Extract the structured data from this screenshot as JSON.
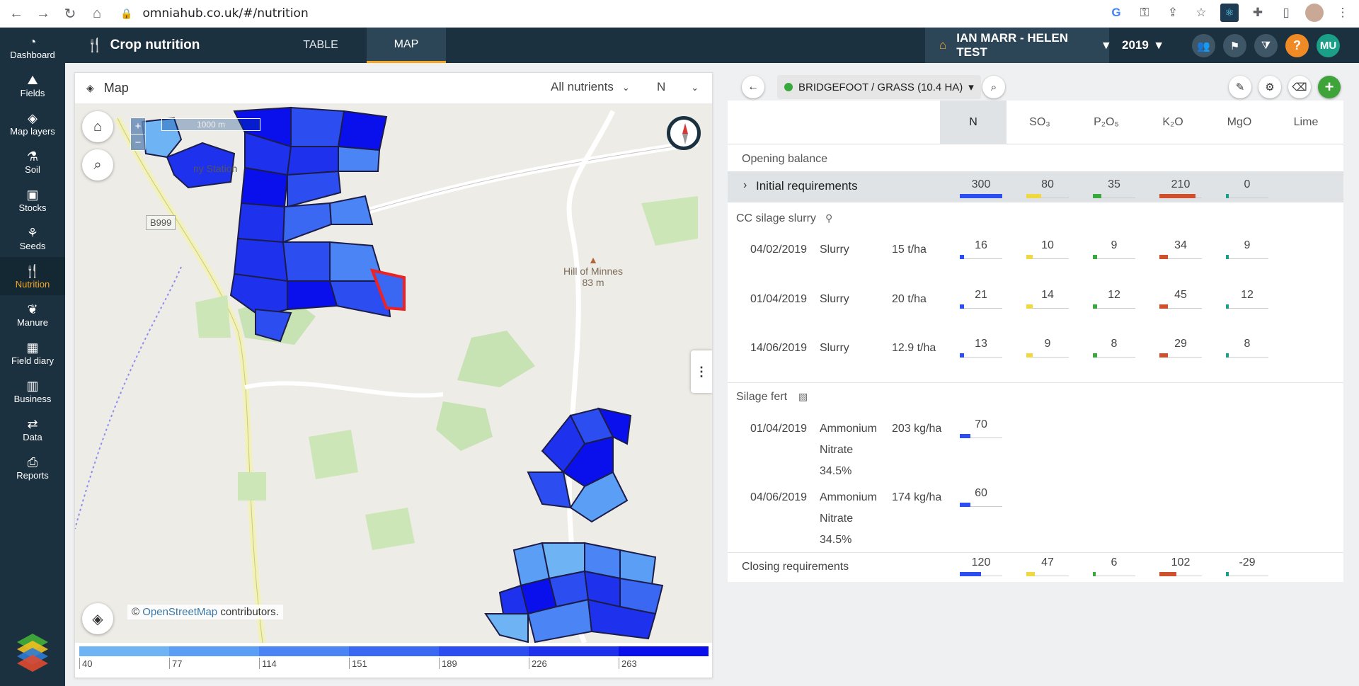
{
  "browser": {
    "url": "omniahub.co.uk/#/nutrition"
  },
  "sidebar": {
    "items": [
      {
        "label": "Dashboard",
        "icon": "dashboard-icon"
      },
      {
        "label": "Fields",
        "icon": "fields-icon"
      },
      {
        "label": "Map layers",
        "icon": "layers-icon"
      },
      {
        "label": "Soil",
        "icon": "flask-icon"
      },
      {
        "label": "Stocks",
        "icon": "stocks-icon"
      },
      {
        "label": "Seeds",
        "icon": "seedling-icon"
      },
      {
        "label": "Nutrition",
        "icon": "utensils-icon"
      },
      {
        "label": "Manure",
        "icon": "manure-icon"
      },
      {
        "label": "Field diary",
        "icon": "calendar-icon"
      },
      {
        "label": "Business",
        "icon": "chart-icon"
      },
      {
        "label": "Data",
        "icon": "transfer-icon"
      },
      {
        "label": "Reports",
        "icon": "reports-icon"
      }
    ]
  },
  "header": {
    "title": "Crop nutrition",
    "tabs": [
      "TABLE",
      "MAP"
    ],
    "farm": "IAN MARR - HELEN TEST",
    "year": "2019",
    "help": "?",
    "user": "MU"
  },
  "map": {
    "title": "Map",
    "nutrient_filter": "All nutrients",
    "nutrient": "N",
    "scale_label": "1000 m",
    "road_label": "B999",
    "place_hill": "Hill of Minnes",
    "place_height": "83 m",
    "place_station": "ny Station",
    "attribution_prefix": "©",
    "attribution_link": "OpenStreetMap",
    "attribution_suffix": "contributors.",
    "legend_ticks": [
      "40",
      "77",
      "114",
      "151",
      "189",
      "226",
      "263"
    ],
    "legend_colors": [
      "#6eb4f5",
      "#5a9ef5",
      "#4a84f5",
      "#3a68f2",
      "#2c4ef0",
      "#1e32ee",
      "#0a10ec"
    ]
  },
  "panel": {
    "field": "BRIDGEFOOT / GRASS (10.4 HA)",
    "columns": [
      "N",
      "SO₃",
      "P₂O₅",
      "K₂O",
      "MgO",
      "Lime"
    ],
    "opening_balance": "Opening balance",
    "initial_requirements": {
      "label": "Initial requirements",
      "values": [
        "300",
        "80",
        "35",
        "210",
        "0"
      ]
    },
    "groups": [
      {
        "name": "CC silage slurry",
        "rows": [
          {
            "date": "04/02/2019",
            "product": "Slurry",
            "rate": "15 t/ha",
            "values": [
              "16",
              "10",
              "9",
              "34",
              "9"
            ]
          },
          {
            "date": "01/04/2019",
            "product": "Slurry",
            "rate": "20 t/ha",
            "values": [
              "21",
              "14",
              "12",
              "45",
              "12"
            ]
          },
          {
            "date": "14/06/2019",
            "product": "Slurry",
            "rate": "12.9 t/ha",
            "values": [
              "13",
              "9",
              "8",
              "29",
              "8"
            ]
          }
        ]
      },
      {
        "name": "Silage fert",
        "rows": [
          {
            "date": "01/04/2019",
            "product_lines": [
              "Ammonium",
              "Nitrate",
              "34.5%"
            ],
            "rate": "203 kg/ha",
            "values": [
              "70"
            ]
          },
          {
            "date": "04/06/2019",
            "product_lines": [
              "Ammonium",
              "Nitrate",
              "34.5%"
            ],
            "rate": "174 kg/ha",
            "values": [
              "60"
            ]
          }
        ]
      }
    ],
    "closing_requirements": {
      "label": "Closing requirements",
      "values": [
        "120",
        "47",
        "6",
        "102",
        "-29"
      ]
    },
    "colors": {
      "N": "#2c4ef0",
      "SO3": "#f0d840",
      "P2O5": "#39a83d",
      "K2O": "#d0502e",
      "MgO": "#1aa088"
    }
  }
}
